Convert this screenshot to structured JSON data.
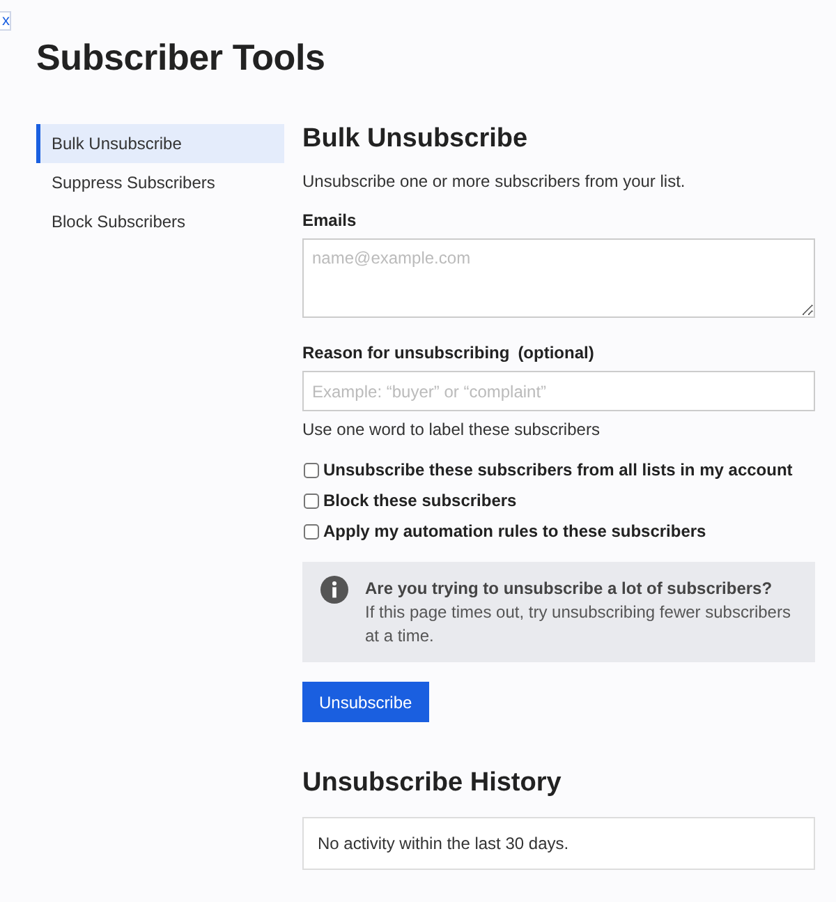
{
  "corner_button": {
    "label": "x"
  },
  "title": "Subscriber Tools",
  "sidebar": {
    "items": [
      {
        "label": "Bulk Unsubscribe",
        "selected": true
      },
      {
        "label": "Suppress Subscribers",
        "selected": false
      },
      {
        "label": "Block Subscribers",
        "selected": false
      }
    ]
  },
  "form": {
    "heading": "Bulk Unsubscribe",
    "description": "Unsubscribe one or more subscribers from your list.",
    "emails": {
      "label": "Emails",
      "placeholder": "name@example.com"
    },
    "reason": {
      "label": "Reason for unsubscribing",
      "optional": "(optional)",
      "placeholder": "Example: “buyer” or “complaint”",
      "help": "Use one word to label these subscribers"
    },
    "options": [
      {
        "label": "Unsubscribe these subscribers from all lists in my account",
        "checked": false
      },
      {
        "label": "Block these subscribers",
        "checked": false
      },
      {
        "label": "Apply my automation rules to these subscribers",
        "checked": false
      }
    ],
    "notice": {
      "title": "Are you trying to unsubscribe a lot of subscribers?",
      "text": "If this page times out, try unsubscribing fewer subscribers at a time."
    },
    "submit": "Unsubscribe"
  },
  "history": {
    "heading": "Unsubscribe History",
    "empty": "No activity within the last 30 days."
  }
}
